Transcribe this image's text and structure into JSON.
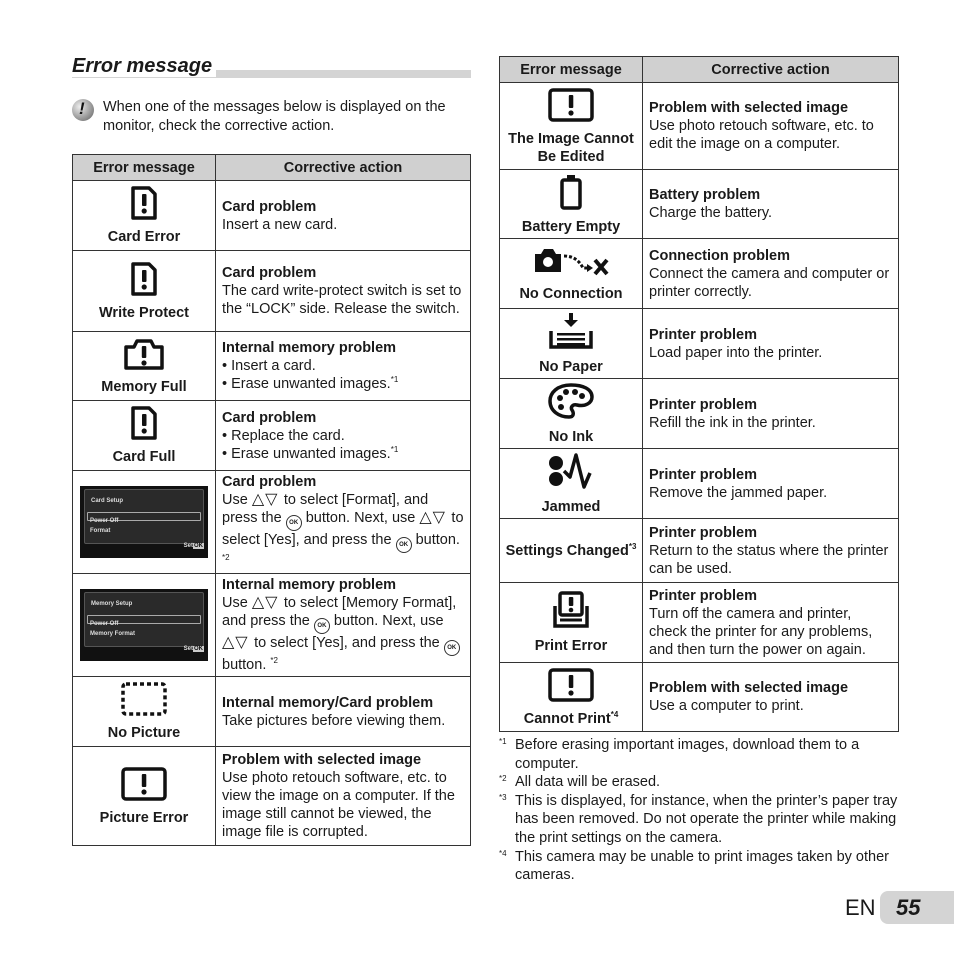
{
  "section": {
    "title": "Error message",
    "note": "When one of the messages below is displayed on the monitor, check the corrective action."
  },
  "table_headers": {
    "message": "Error message",
    "action": "Corrective action"
  },
  "left_rows": [
    {
      "icon": "card-error-icon",
      "message": "Card Error",
      "heading": "Card problem",
      "lines": [
        "Insert a new card."
      ]
    },
    {
      "icon": "card-error-icon",
      "message": "Write Protect",
      "heading": "Card problem",
      "lines": [
        "The card write-protect switch is set to the “LOCK” side. Release the switch."
      ]
    },
    {
      "icon": "memory-error-icon",
      "message": "Memory Full",
      "heading": "Internal memory problem",
      "bullets": [
        "Insert a card.",
        "Erase unwanted images."
      ],
      "bullet_note": "*1"
    },
    {
      "icon": "card-error-icon",
      "message": "Card Full",
      "heading": "Card problem",
      "bullets": [
        "Replace the card.",
        "Erase unwanted images."
      ],
      "bullet_note": "*1"
    },
    {
      "screen": {
        "title": "Card Setup",
        "option1": "Power Off",
        "option2": "Format",
        "set": "Set",
        "ok": "OK"
      },
      "heading": "Card problem",
      "parts": [
        "Use",
        "to select [Format], and press the",
        "button. Next, use",
        "to select [Yes], and press the",
        "button."
      ],
      "note": "*2"
    },
    {
      "screen": {
        "title": "Memory Setup",
        "option1": "Power Off",
        "option2": "Memory Format",
        "set": "Set",
        "ok": "OK"
      },
      "heading": "Internal memory problem",
      "parts": [
        "Use",
        "to select [Memory Format], and press the",
        "button. Next, use",
        "to select [Yes], and press the",
        "button."
      ],
      "note": "*2"
    },
    {
      "icon": "no-picture-icon",
      "message": "No Picture",
      "heading": "Internal memory/Card problem",
      "lines": [
        "Take pictures before viewing them."
      ]
    },
    {
      "icon": "picture-error-icon",
      "message": "Picture Error",
      "heading": "Problem with selected image",
      "lines": [
        "Use photo retouch software, etc. to view the image on a computer. If the image still cannot be viewed, the image file is corrupted."
      ]
    }
  ],
  "right_rows": [
    {
      "icon": "picture-error-icon",
      "message": "The Image Cannot Be Edited",
      "heading": "Problem with selected image",
      "lines": [
        "Use photo retouch software, etc. to edit the image on a computer."
      ]
    },
    {
      "icon": "battery-empty-icon",
      "message": "Battery Empty",
      "heading": "Battery problem",
      "lines": [
        "Charge the battery."
      ]
    },
    {
      "icon": "no-connection-icon",
      "message": "No Connection",
      "heading": "Connection problem",
      "lines": [
        "Connect the camera and computer or printer correctly."
      ]
    },
    {
      "icon": "no-paper-icon",
      "message": "No Paper",
      "heading": "Printer problem",
      "lines": [
        "Load paper into the printer."
      ]
    },
    {
      "icon": "no-ink-icon",
      "message": "No Ink",
      "heading": "Printer problem",
      "lines": [
        "Refill the ink in the printer."
      ]
    },
    {
      "icon": "jammed-icon",
      "message": "Jammed",
      "heading": "Printer problem",
      "lines": [
        "Remove the jammed paper."
      ]
    },
    {
      "message": "Settings Changed",
      "message_note": "*3",
      "heading": "Printer problem",
      "lines": [
        "Return to the status where the printer can be used."
      ]
    },
    {
      "icon": "print-error-icon",
      "message": "Print Error",
      "heading": "Printer problem",
      "lines": [
        "Turn off the camera and printer, check the printer for any problems, and then turn the power on again."
      ]
    },
    {
      "icon": "picture-error-icon",
      "message": "Cannot Print",
      "message_note": "*4",
      "heading": "Problem with selected image",
      "lines": [
        "Use a computer to print."
      ]
    }
  ],
  "footnotes": [
    {
      "mark": "*1",
      "text": "Before erasing important images, download them to a computer."
    },
    {
      "mark": "*2",
      "text": "All data will be erased."
    },
    {
      "mark": "*3",
      "text": "This is displayed, for instance, when the printer’s paper tray has been removed. Do not operate the printer while making the print settings on the camera."
    },
    {
      "mark": "*4",
      "text": "This camera may be unable to print images taken by other cameras."
    }
  ],
  "page": {
    "language": "EN",
    "number": "55"
  },
  "symbols": {
    "updown": "△▽",
    "ok": "OK"
  }
}
